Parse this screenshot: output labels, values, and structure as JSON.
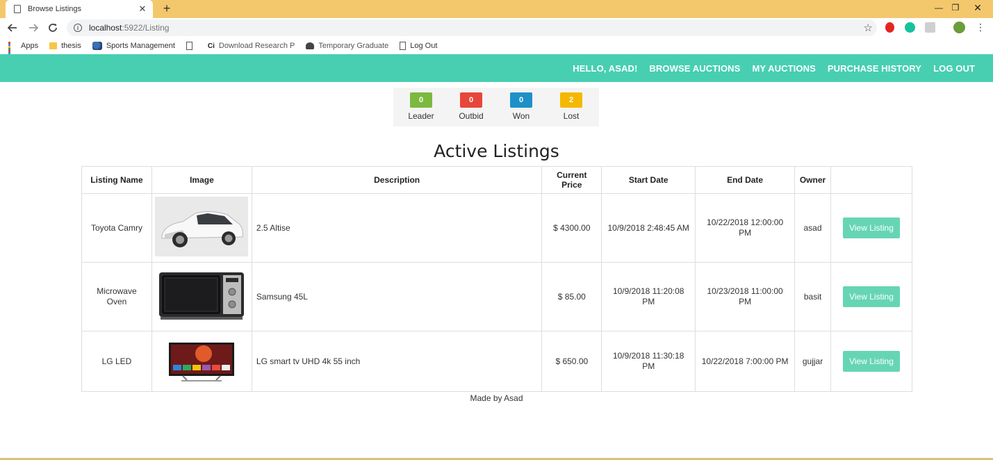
{
  "browser": {
    "tab_title": "Browse Listings",
    "url_host": "localhost",
    "url_path": ":5922/Listing",
    "bookmarks": [
      {
        "label": "Apps",
        "icon": "apps-grid-icon"
      },
      {
        "label": "thesis",
        "icon": "folder-icon"
      },
      {
        "label": "Sports Management",
        "icon": "sports-icon"
      },
      {
        "label": "",
        "icon": "page-icon"
      },
      {
        "label": "Download Research P",
        "icon": "ci-icon"
      },
      {
        "label": "Temporary Graduate",
        "icon": "gov-icon"
      },
      {
        "label": "Log Out",
        "icon": "page-icon"
      }
    ]
  },
  "navbar": {
    "greeting": "HELLO, ASAD!",
    "browse": "BROWSE AUCTIONS",
    "my_auctions": "MY AUCTIONS",
    "purchase_history": "PURCHASE HISTORY",
    "logout": "LOG OUT",
    "color": "#48cfb2"
  },
  "stats": [
    {
      "count": "0",
      "label": "Leader",
      "color": "#7cb940"
    },
    {
      "count": "0",
      "label": "Outbid",
      "color": "#e8463a"
    },
    {
      "count": "0",
      "label": "Won",
      "color": "#1e90c8"
    },
    {
      "count": "2",
      "label": "Lost",
      "color": "#f5b800"
    }
  ],
  "heading": "Active Listings",
  "table": {
    "headers": {
      "name": "Listing Name",
      "image": "Image",
      "description": "Description",
      "price": "Current Price",
      "start": "Start Date",
      "end": "End Date",
      "owner": "Owner"
    },
    "rows": [
      {
        "name": "Toyota Camry",
        "image": "car-image",
        "description": "2.5 Altise",
        "price": "$ 4300.00",
        "start": "10/9/2018 2:48:45 AM",
        "end": "10/22/2018 12:00:00 PM",
        "owner": "asad",
        "action": "View Listing"
      },
      {
        "name": "Microwave Oven",
        "image": "microwave-image",
        "description": "Samsung 45L",
        "price": "$ 85.00",
        "start": "10/9/2018 11:20:08 PM",
        "end": "10/23/2018 11:00:00 PM",
        "owner": "basit",
        "action": "View Listing"
      },
      {
        "name": "LG LED",
        "image": "tv-image",
        "description": "LG smart tv UHD 4k 55 inch",
        "price": "$ 650.00",
        "start": "10/9/2018 11:30:18 PM",
        "end": "10/22/2018 7:00:00 PM",
        "owner": "gujjar",
        "action": "View Listing"
      }
    ]
  },
  "footer": "Made by Asad"
}
